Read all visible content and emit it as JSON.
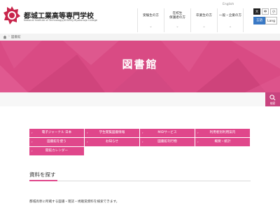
{
  "header": {
    "school_name": "都城工業高等専門学校",
    "school_name_en": "National Institute of Technology(KOSEN),Miyakonojo College",
    "english_link": "English",
    "nav": [
      {
        "label1": "受験生の方",
        "label2": ""
      },
      {
        "label1": "在校生",
        "label2": "保護者の方"
      },
      {
        "label1": "卒業生の方",
        "label2": ""
      },
      {
        "label1": "一般・企業の方",
        "label2": ""
      }
    ],
    "font_size": {
      "large": "大",
      "medium": "中",
      "small": "小"
    },
    "lang": {
      "left": "言語",
      "right": "Lang"
    }
  },
  "breadcrumb": {
    "current": "図書館"
  },
  "hero": {
    "title": "図書館"
  },
  "search_tab": {
    "label": "検索"
  },
  "links": [
    "電子ジャーナル 日本",
    "学生閲覧図書情報",
    "MIDサービス",
    "利用者別利用案内",
    "図書館を使う",
    "お知らせ",
    "図書館刊行物",
    "概要・統計",
    "開館カレンダー"
  ],
  "section": {
    "title": "資料を探す",
    "description": "都城高専に所蔵する図書・雑誌・視聴覚資料を検索できます。"
  },
  "colors": {
    "accent": "#e0478b",
    "hero": "#d94b84",
    "lang_active": "#3a79c5"
  }
}
